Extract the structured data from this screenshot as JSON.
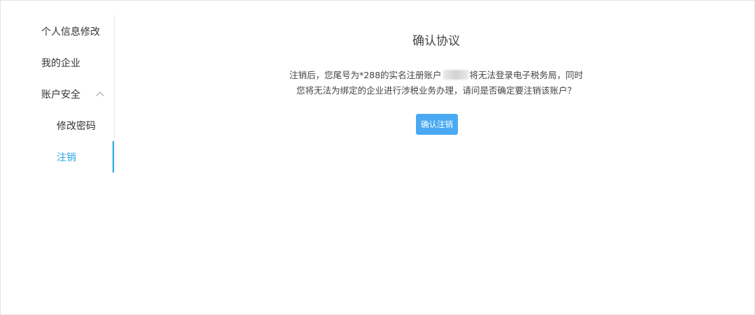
{
  "sidebar": {
    "items": [
      {
        "label": "个人信息修改"
      },
      {
        "label": "我的企业"
      },
      {
        "label": "账户安全"
      },
      {
        "label": "修改密码"
      },
      {
        "label": "注销"
      }
    ],
    "active_color": "#2aa7e6"
  },
  "main": {
    "title": "确认协议",
    "desc_line1_before": "注销后，您尾号为*288的实名注册账户",
    "desc_line1_after": "将无法登录电子税务局，同时",
    "desc_line2": "您将无法为绑定的企业进行涉税业务办理，请问是否确定要注销该账户？",
    "confirm_label": "确认注销",
    "button_color": "#4aa9f3"
  }
}
